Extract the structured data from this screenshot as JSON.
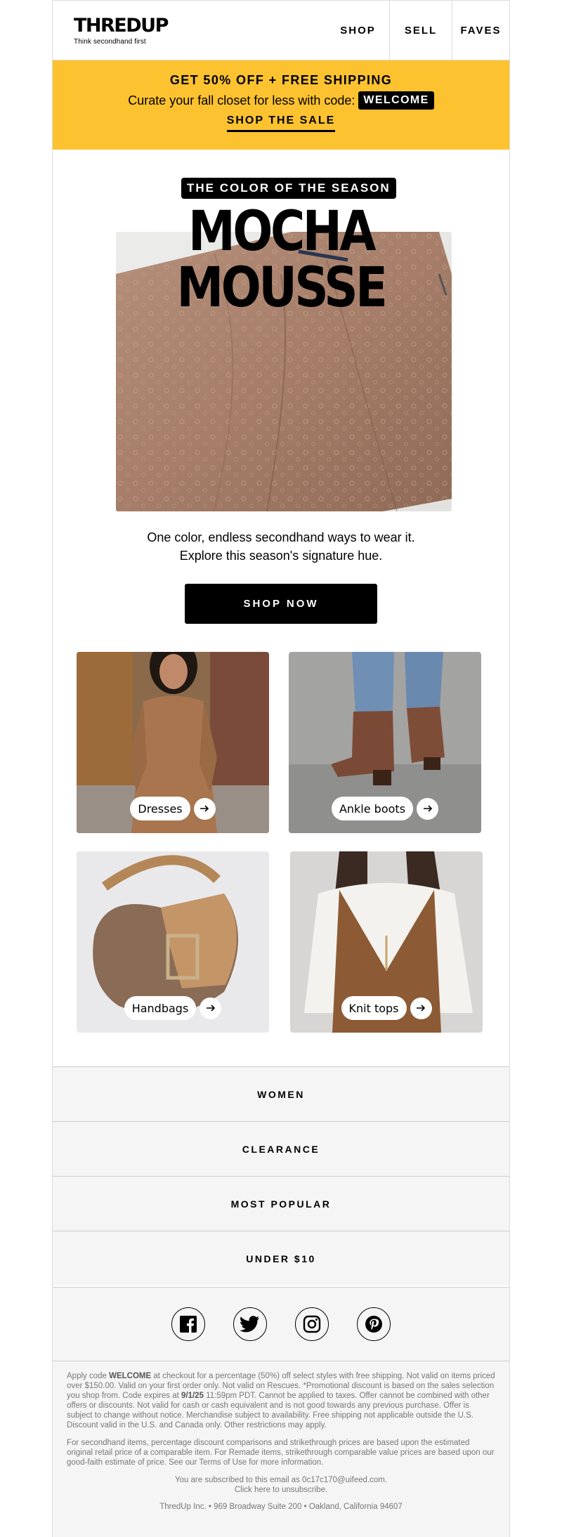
{
  "header": {
    "logo_text": "THREDUP",
    "tagline": "Think secondhand first",
    "nav": [
      "SHOP",
      "SELL",
      "FAVES"
    ]
  },
  "promo": {
    "headline": "GET 50% OFF + FREE SHIPPING",
    "subline": "Curate your fall closet for less with code:",
    "code": "WELCOME",
    "cta": "SHOP THE SALE",
    "bg_color": "#fdc230"
  },
  "hero": {
    "eyebrow": "THE COLOR OF THE SEASON",
    "title": "MOCHA MOUSSE",
    "line1": "One color, endless secondhand ways to wear it.",
    "line2": "Explore this season's signature hue.",
    "cta": "SHOP NOW"
  },
  "tiles": [
    {
      "label": "Dresses"
    },
    {
      "label": "Ankle boots"
    },
    {
      "label": "Handbags"
    },
    {
      "label": "Knit tops"
    }
  ],
  "categories": [
    "WOMEN",
    "CLEARANCE",
    "MOST POPULAR",
    "UNDER $10"
  ],
  "social": [
    "facebook-icon",
    "twitter-icon",
    "instagram-icon",
    "pinterest-icon"
  ],
  "legal": {
    "p1_a": "Apply code ",
    "p1_code": "WELCOME",
    "p1_b": " at checkout for a percentage (50%) off select styles with free shipping. Not valid on items priced over $150.00. Valid on your first order only. Not valid on Rescues. *Promotional discount is based on the sales selection you shop from. Code expires at ",
    "p1_date": "9/1/25",
    "p1_c": " 11:59pm PDT. Cannot be applied to taxes. Offer cannot be combined with other offers or discounts. Not valid for cash or cash equivalent and is not good towards any previous purchase. Offer is subject to change without notice. Merchandise subject to availability. Free shipping not applicable outside the U.S. Discount valid in the U.S. and Canada only. Other restrictions may apply.",
    "p2": "For secondhand items, percentage discount comparisons and strikethrough prices are based upon the estimated original retail price of a comparable item. For Remade items, strikethrough comparable value prices are based upon our good-faith estimate of price. See our Terms of Use for more information.",
    "subscribed": "You are subscribed to this email as 0c17c170@uifeed.com.",
    "unsubscribe": "Click here to unsubscribe.",
    "address": "ThredUp Inc. • 969 Broadway Suite 200 • Oakland, California 94607"
  }
}
